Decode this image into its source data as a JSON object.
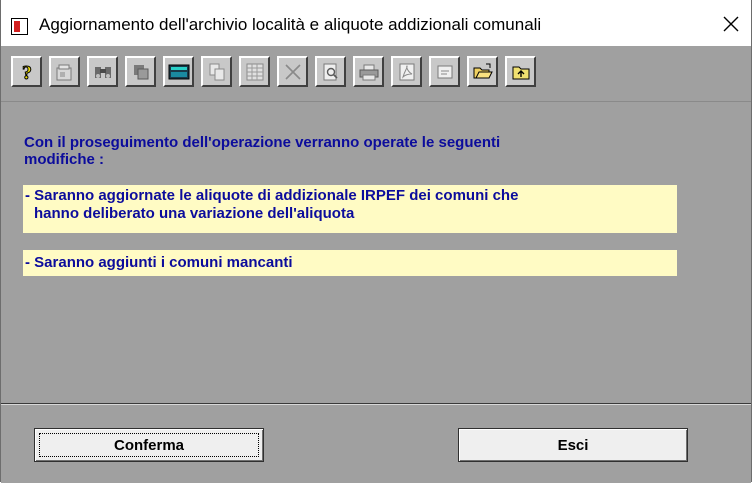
{
  "window": {
    "title": "Aggiornamento dell'archivio località e aliquote addizionali comunali"
  },
  "toolbar": {
    "buttons": [
      {
        "icon": "help-icon"
      },
      {
        "icon": "properties-icon"
      },
      {
        "icon": "binoculars-icon"
      },
      {
        "icon": "grid-select-icon"
      },
      {
        "icon": "calculator-icon"
      },
      {
        "icon": "copy-icon"
      },
      {
        "icon": "table-icon"
      },
      {
        "icon": "delete-icon"
      },
      {
        "icon": "print-preview-icon"
      },
      {
        "icon": "print-icon"
      },
      {
        "icon": "pdf-icon"
      },
      {
        "icon": "note-icon"
      },
      {
        "icon": "open-folder-icon"
      },
      {
        "icon": "up-folder-icon"
      }
    ]
  },
  "message": {
    "intro_line1": "Con il proseguimento dell'operazione verranno operate le seguenti",
    "intro_line2": "modifiche :",
    "note1_line1": "- Saranno aggiornate le aliquote di addizionale IRPEF dei comuni che",
    "note1_line2": "hanno deliberato una variazione dell'aliquota",
    "note2": "- Saranno aggiunti i comuni mancanti"
  },
  "actions": {
    "confirm_label": "Conferma",
    "exit_label": "Esci"
  },
  "colors": {
    "text_blue": "#0c0c9c",
    "note_bg": "#fffbc4",
    "panel_bg": "#a0a0a0"
  }
}
